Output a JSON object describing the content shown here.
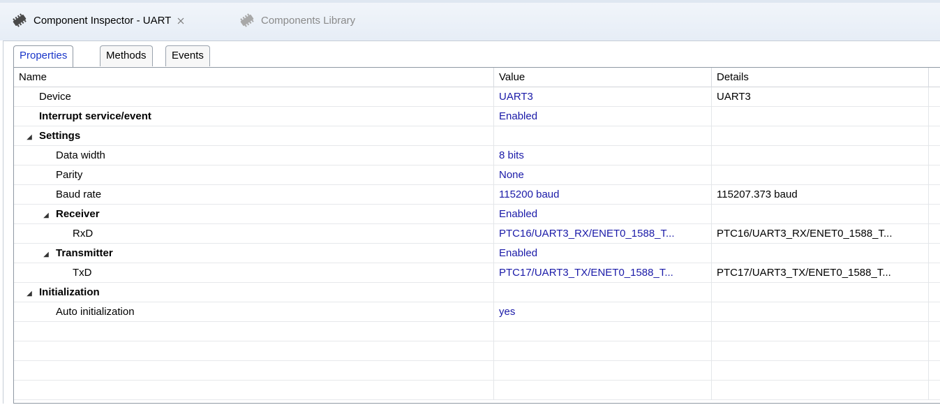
{
  "view_tabs": [
    {
      "label": "Component Inspector - UART",
      "icon": "component-icon",
      "active": true,
      "closable": true
    },
    {
      "label": "Components Library",
      "icon": "component-icon",
      "active": false
    }
  ],
  "sub_tabs": [
    {
      "label": "Properties",
      "active": true
    },
    {
      "label": "Methods",
      "active": false
    },
    {
      "label": "Events",
      "active": false
    }
  ],
  "table": {
    "columns": [
      "Name",
      "Value",
      "Details"
    ],
    "rows": [
      {
        "name": "Device",
        "value": "UART3",
        "details": "UART3",
        "bold": false,
        "indent": 0,
        "expanded": null
      },
      {
        "name": "Interrupt service/event",
        "value": "Enabled",
        "details": "",
        "bold": true,
        "indent": 0,
        "expanded": null
      },
      {
        "name": "Settings",
        "value": "",
        "details": "",
        "bold": true,
        "indent": 0,
        "expanded": true
      },
      {
        "name": "Data width",
        "value": "8 bits",
        "details": "",
        "bold": false,
        "indent": 1,
        "expanded": null
      },
      {
        "name": "Parity",
        "value": "None",
        "details": "",
        "bold": false,
        "indent": 1,
        "expanded": null
      },
      {
        "name": "Baud rate",
        "value": "115200 baud",
        "details": "115207.373 baud",
        "bold": false,
        "indent": 1,
        "expanded": null
      },
      {
        "name": "Receiver",
        "value": "Enabled",
        "details": "",
        "bold": true,
        "indent": 1,
        "expanded": true
      },
      {
        "name": "RxD",
        "value": "PTC16/UART3_RX/ENET0_1588_T...",
        "details": "PTC16/UART3_RX/ENET0_1588_T...",
        "bold": false,
        "indent": 2,
        "expanded": null
      },
      {
        "name": "Transmitter",
        "value": "Enabled",
        "details": "",
        "bold": true,
        "indent": 1,
        "expanded": true
      },
      {
        "name": "TxD",
        "value": "PTC17/UART3_TX/ENET0_1588_T...",
        "details": "PTC17/UART3_TX/ENET0_1588_T...",
        "bold": false,
        "indent": 2,
        "expanded": null
      },
      {
        "name": "Initialization",
        "value": "",
        "details": "",
        "bold": true,
        "indent": 0,
        "expanded": true
      },
      {
        "name": "Auto initialization",
        "value": "yes",
        "details": "",
        "bold": false,
        "indent": 1,
        "expanded": null
      }
    ],
    "empty_rows": 4
  },
  "colors": {
    "value_text": "#1a1aa8",
    "active_tab_text": "#1a36c9",
    "inactive_tab_text": "#8a8a8a"
  }
}
